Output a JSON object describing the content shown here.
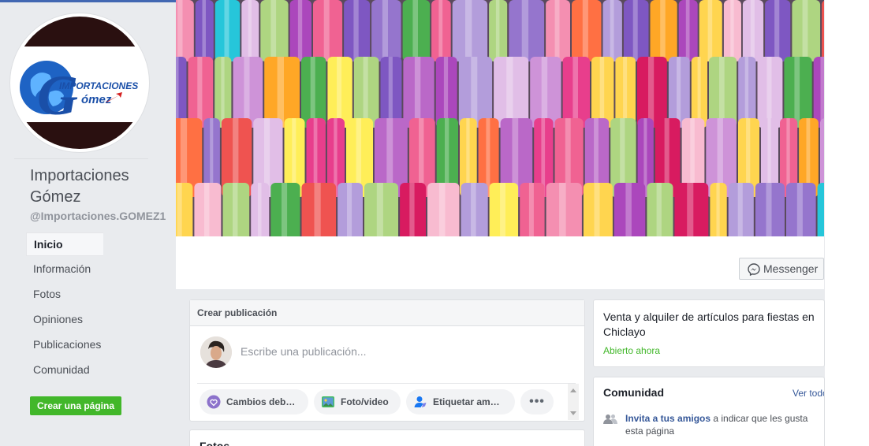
{
  "page": {
    "name": "Importaciones Gómez",
    "handle": "@Importaciones.GOMEZ1",
    "logo_text_top": "IMPORTACIONES",
    "logo_text_bottom": "ómez",
    "logo_letter": "G"
  },
  "nav": {
    "items": [
      {
        "label": "Inicio",
        "active": true
      },
      {
        "label": "Información"
      },
      {
        "label": "Fotos"
      },
      {
        "label": "Opiniones"
      },
      {
        "label": "Publicaciones"
      },
      {
        "label": "Comunidad"
      }
    ],
    "create_page_label": "Crear una página"
  },
  "cover": {
    "messenger_label": "Messenger"
  },
  "composer": {
    "header": "Crear publicación",
    "placeholder": "Escribe una publicación...",
    "actions": [
      {
        "label": "Cambios deb…",
        "icon": "heart-circle-icon"
      },
      {
        "label": "Foto/video",
        "icon": "photo-icon"
      },
      {
        "label": "Etiquetar am…",
        "icon": "tag-person-icon"
      },
      {
        "label": "•••",
        "icon": "more-icon"
      }
    ]
  },
  "fotos": {
    "title": "Fotos"
  },
  "about": {
    "description": "Venta y alquiler de artículos para fiestas en Chiclayo",
    "status": "Abierto ahora"
  },
  "community": {
    "title": "Comunidad",
    "see_all": "Ver todo",
    "invite_link": "Invita a tus amigos",
    "invite_rest": " a indicar que les gusta esta página"
  },
  "colors": {
    "brand_blue": "#4267b2",
    "link": "#365899",
    "green": "#42b72a"
  }
}
